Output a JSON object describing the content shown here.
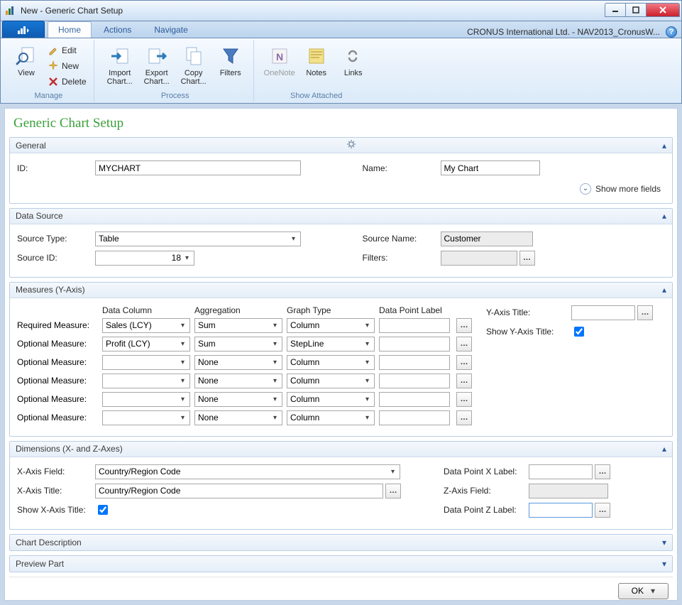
{
  "window": {
    "title": "New - Generic Chart Setup",
    "company_db": "CRONUS International Ltd. - NAV2013_CronusW..."
  },
  "tabs": {
    "home": "Home",
    "actions": "Actions",
    "navigate": "Navigate"
  },
  "ribbon": {
    "manage": {
      "group": "Manage",
      "view": "View",
      "edit": "Edit",
      "new": "New",
      "delete": "Delete"
    },
    "process": {
      "group": "Process",
      "import": "Import Chart...",
      "export": "Export Chart...",
      "copy": "Copy Chart...",
      "filters": "Filters"
    },
    "attached": {
      "group": "Show Attached",
      "onenote": "OneNote",
      "notes": "Notes",
      "links": "Links"
    }
  },
  "page_title": "Generic Chart Setup",
  "sections": {
    "general": "General",
    "datasource": "Data Source",
    "measures": "Measures (Y-Axis)",
    "dimensions": "Dimensions (X- and Z-Axes)",
    "chartdesc": "Chart Description",
    "previewpart": "Preview Part"
  },
  "general": {
    "id_label": "ID:",
    "id_value": "MYCHART",
    "name_label": "Name:",
    "name_value": "My Chart",
    "show_more": "Show more fields"
  },
  "datasource": {
    "type_label": "Source Type:",
    "type_value": "Table",
    "id_label": "Source ID:",
    "id_value": "18",
    "name_label": "Source Name:",
    "name_value": "Customer",
    "filters_label": "Filters:",
    "filters_value": ""
  },
  "measures": {
    "headers": {
      "dc": "Data Column",
      "ag": "Aggregation",
      "gt": "Graph Type",
      "dp": "Data Point Label"
    },
    "yaxis_title_label": "Y-Axis Title:",
    "yaxis_title_value": "",
    "show_yaxis_label": "Show Y-Axis Title:",
    "show_yaxis_value": true,
    "rows": [
      {
        "label": "Required Measure:",
        "dc": "Sales (LCY)",
        "ag": "Sum",
        "gt": "Column",
        "dp": ""
      },
      {
        "label": "Optional Measure:",
        "dc": "Profit (LCY)",
        "ag": "Sum",
        "gt": "StepLine",
        "dp": ""
      },
      {
        "label": "Optional Measure:",
        "dc": "",
        "ag": "None",
        "gt": "Column",
        "dp": ""
      },
      {
        "label": "Optional Measure:",
        "dc": "",
        "ag": "None",
        "gt": "Column",
        "dp": ""
      },
      {
        "label": "Optional Measure:",
        "dc": "",
        "ag": "None",
        "gt": "Column",
        "dp": ""
      },
      {
        "label": "Optional Measure:",
        "dc": "",
        "ag": "None",
        "gt": "Column",
        "dp": ""
      }
    ]
  },
  "dimensions": {
    "xfield_label": "X-Axis Field:",
    "xfield_value": "Country/Region Code",
    "xtitle_label": "X-Axis Title:",
    "xtitle_value": "Country/Region Code",
    "showx_label": "Show X-Axis Title:",
    "showx_value": true,
    "dpx_label": "Data Point X Label:",
    "dpx_value": "",
    "zfield_label": "Z-Axis Field:",
    "zfield_value": "",
    "dpz_label": "Data Point Z Label:",
    "dpz_value": ""
  },
  "footer": {
    "ok": "OK"
  }
}
